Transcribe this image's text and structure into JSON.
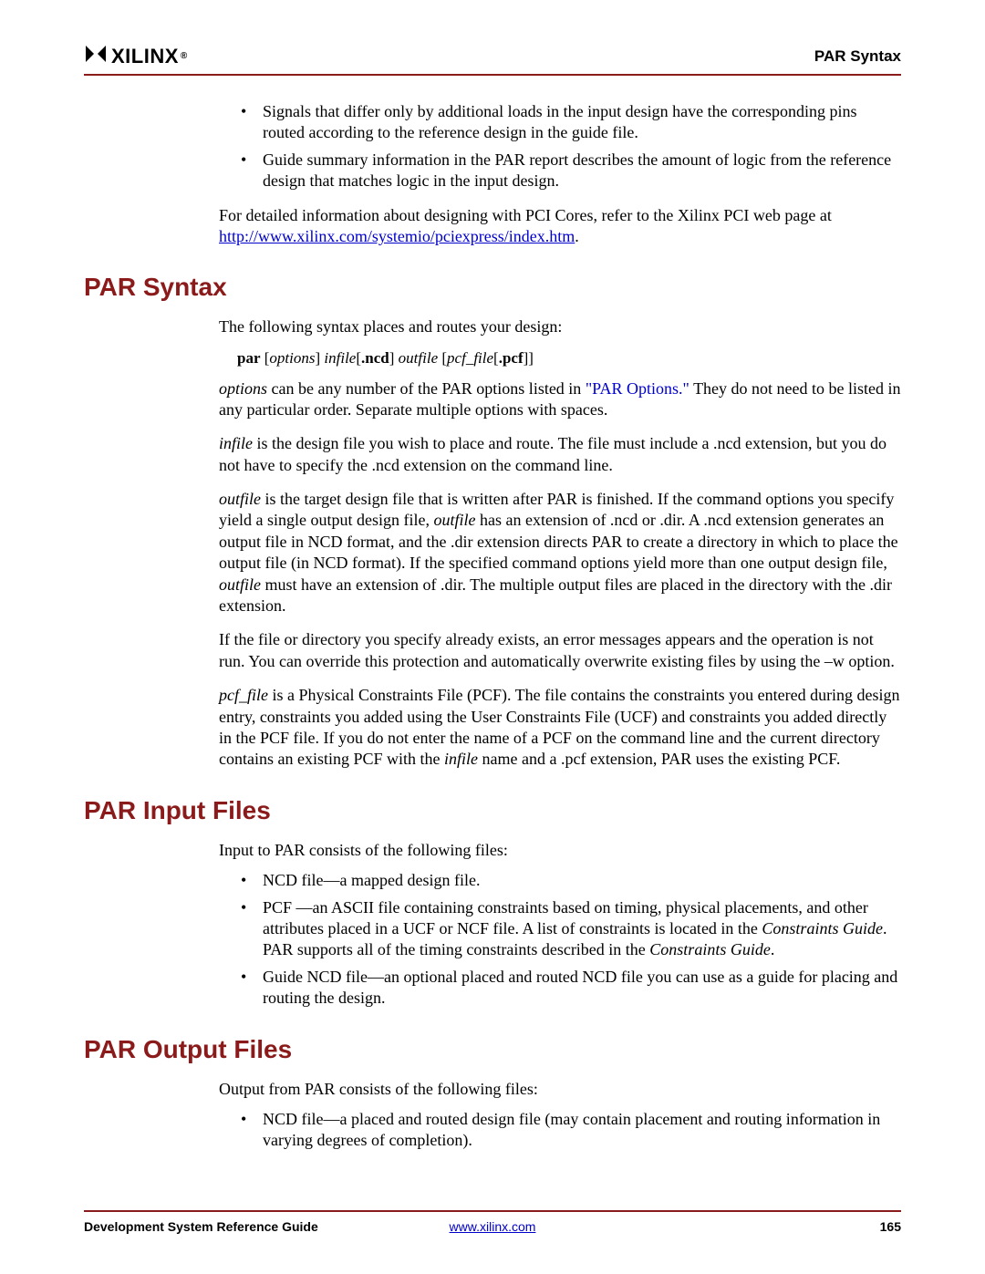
{
  "header": {
    "logo_text": "XILINX",
    "logo_reg": "®",
    "running_title": "PAR Syntax"
  },
  "intro": {
    "bullet1": "Signals that differ only by additional loads in the input design have the corresponding pins routed according to the reference design in the guide file.",
    "bullet2": "Guide summary information in the PAR report describes the amount of logic from the reference design that matches logic in the input design.",
    "para_before_link": "For detailed information about designing with PCI Cores, refer to the Xilinx PCI web page at ",
    "link_text": "http://www.xilinx.com/systemio/pciexpress/index.htm",
    "para_after_link": "."
  },
  "syntax": {
    "heading": "PAR Syntax",
    "p1": "The following syntax places and routes your design:",
    "cmd": {
      "par": "par",
      "lb1": " [",
      "options": "options",
      "rb1": "] ",
      "infile": "infile",
      "lb2": "[",
      "ncd": ".ncd",
      "rb2": "] ",
      "outfile": "outfile",
      "sp": " ",
      "lb3": "[",
      "pcf_file": "pcf_file",
      "lb4": "[",
      "pcf": ".pcf",
      "rb4": "]",
      "rb3": "]"
    },
    "p2a": "options",
    "p2b": " can be any number of the PAR options listed in ",
    "p2_xref": "\"PAR Options.\"",
    "p2c": " They do not need to be listed in any particular order. Separate multiple options with spaces.",
    "p3a": "infile",
    "p3b": " is the design file you wish to place and route. The file must include a .ncd extension, but you do not have to specify the .ncd extension on the command line.",
    "p4a": "outfile",
    "p4b": " is the target design file that is written after PAR is finished. If the command options you specify yield a single output design file, ",
    "p4c": "outfile",
    "p4d": " has an extension of .ncd or .dir. A .ncd extension generates an output file in NCD format, and the .dir extension directs PAR to create a directory in which to place the output file (in NCD format). If the specified command options yield more than one output design file, ",
    "p4e": "outfile",
    "p4f": " must have an extension of .dir. The multiple output files are placed in the directory with the .dir extension.",
    "p5": "If the file or directory you specify already exists, an error messages appears and the operation is not run. You can override this protection and automatically overwrite existing files by using the –w option.",
    "p6a": "pcf_file",
    "p6b": " is a Physical Constraints File (PCF). The file contains the constraints you entered during design entry, constraints you added using the User Constraints File (UCF) and constraints you added directly in the PCF file. If you do not enter the name of a PCF on the command line and the current directory contains an existing PCF with the ",
    "p6c": "infile",
    "p6d": " name and a .pcf extension, PAR uses the existing PCF."
  },
  "input_files": {
    "heading": "PAR Input Files",
    "intro": "Input to PAR consists of the following files:",
    "b1": "NCD file—a mapped design file.",
    "b2a": "PCF —an ASCII file containing constraints based on timing, physical placements, and other attributes placed in a UCF or NCF file. A list of constraints is located in the ",
    "b2b": "Constraints Guide",
    "b2c": ". PAR supports all of the timing constraints described in the ",
    "b2d": "Constraints Guide",
    "b2e": ".",
    "b3": "Guide NCD file—an optional placed and routed NCD file you can use as a guide for placing and routing the design."
  },
  "output_files": {
    "heading": "PAR Output Files",
    "intro": "Output from PAR consists of the following files:",
    "b1": "NCD file—a placed and routed design file (may contain placement and routing information in varying degrees of completion)."
  },
  "footer": {
    "left": "Development System Reference Guide",
    "center": "www.xilinx.com",
    "page": "165"
  }
}
